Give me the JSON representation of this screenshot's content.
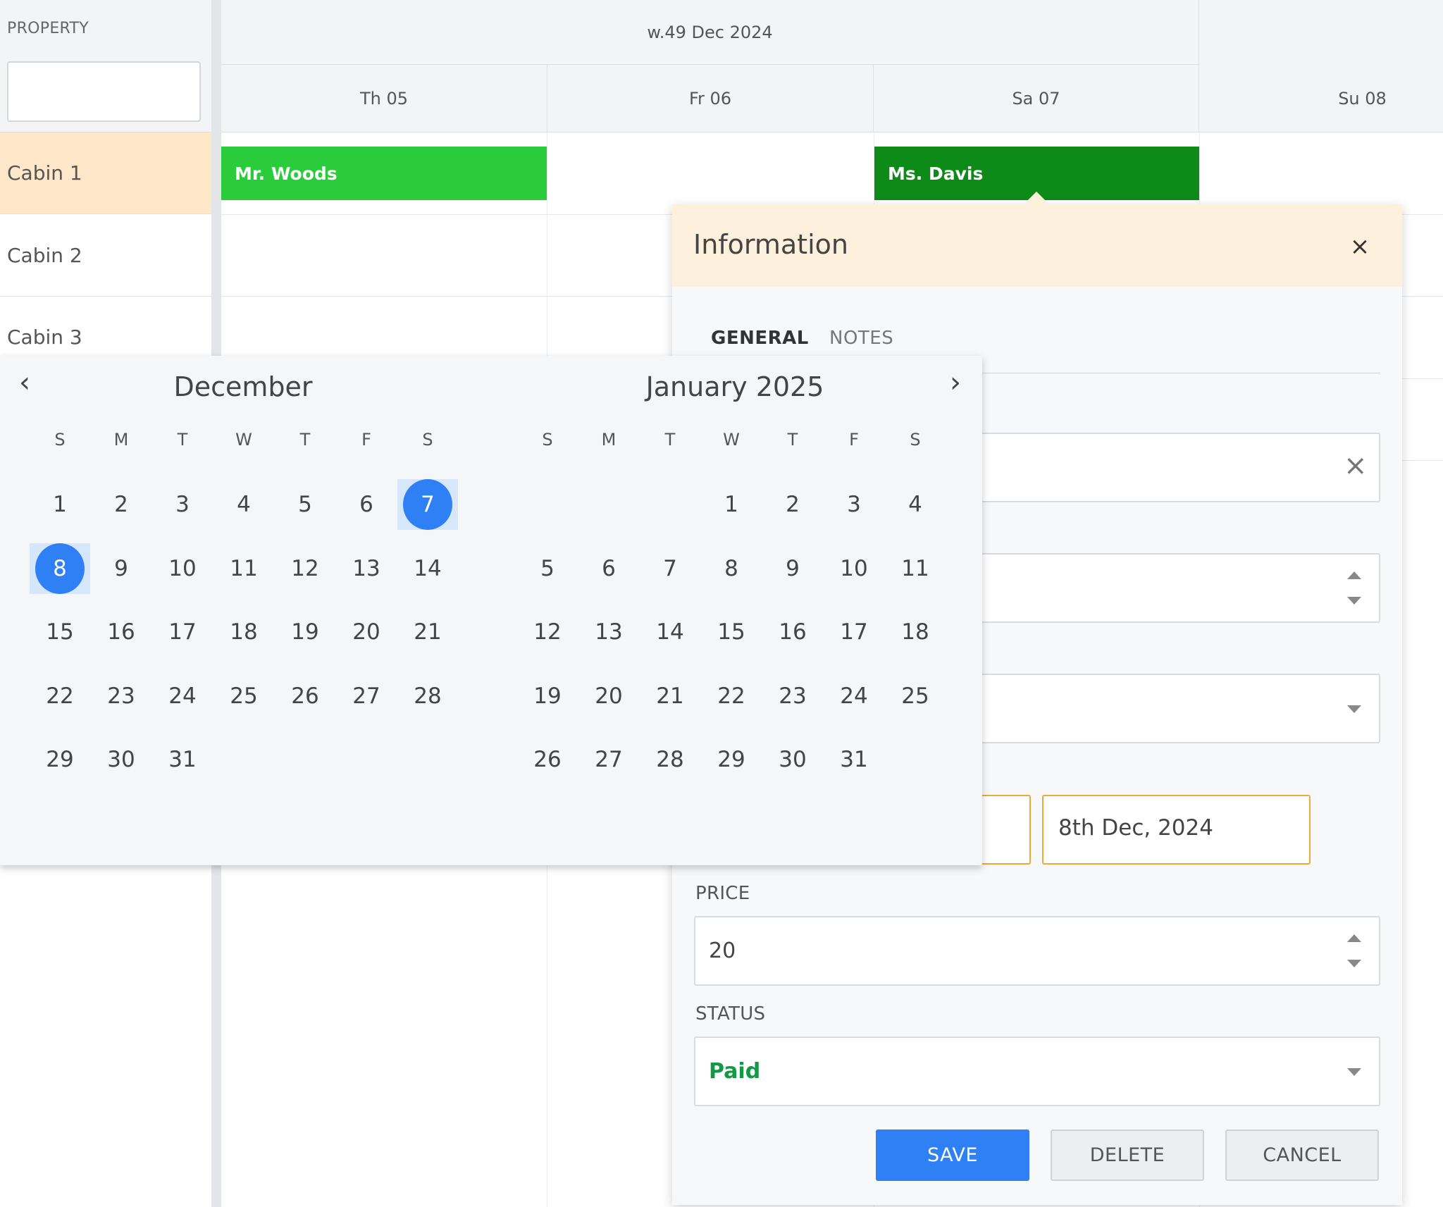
{
  "scheduler": {
    "property_header": "PROPERTY",
    "week_label": "w.49 Dec 2024",
    "days": [
      "Th 05",
      "Fr 06",
      "Sa 07",
      "Su 08"
    ],
    "rows": [
      "Cabin 1",
      "Cabin 2",
      "Cabin 3"
    ],
    "events": [
      {
        "name": "Mr. Woods",
        "color": "#2bcc3b"
      },
      {
        "name": "Ms. Davis",
        "color": "#0d8a17"
      }
    ]
  },
  "dialog": {
    "title": "Information",
    "close_icon": "×",
    "tabs": [
      "GENERAL",
      "NOTES"
    ],
    "end_date": "8th Dec, 2024",
    "price_label": "PRICE",
    "price_value": "20",
    "status_label": "STATUS",
    "status_value": "Paid",
    "status_color": "#119944",
    "buttons": {
      "save": "SAVE",
      "delete": "DELETE",
      "cancel": "CANCEL"
    },
    "clear_icon": "×"
  },
  "picker": {
    "prev_icon": "‹",
    "next_icon": "›",
    "weekdays": [
      "S",
      "M",
      "T",
      "W",
      "T",
      "F",
      "S"
    ],
    "months": [
      {
        "title": "December",
        "first_weekday": 0,
        "days_in_month": 31
      },
      {
        "title": "January 2025",
        "first_weekday": 3,
        "days_in_month": 31
      }
    ],
    "selected_start": {
      "month": 0,
      "day": 7
    },
    "selected_end": {
      "month": 0,
      "day": 8
    },
    "accent": "#2f7ff5"
  }
}
